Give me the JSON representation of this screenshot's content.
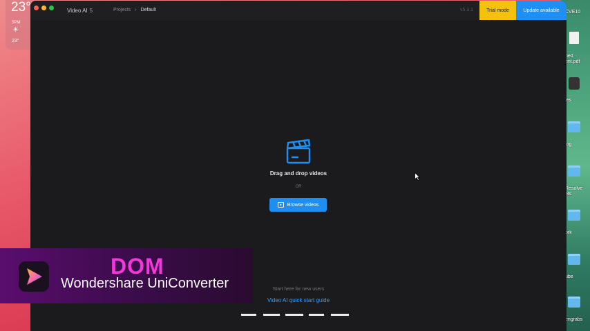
{
  "weather": {
    "temp": "23°",
    "time": "5PM",
    "low": "23°"
  },
  "desktop": {
    "items": [
      {
        "label": "CVE10"
      },
      {
        "label": "ned"
      },
      {
        "label": "ent.pdf"
      },
      {
        "label": "ies"
      },
      {
        "label": "log"
      },
      {
        "label": "Resolve"
      },
      {
        "label": "ets"
      },
      {
        "label": "ork"
      },
      {
        "label": "ube"
      },
      {
        "label": "engrabs"
      }
    ]
  },
  "app": {
    "title": "Video AI",
    "version": "5",
    "breadcrumb": {
      "root": "Projects",
      "current": "Default"
    },
    "version_tag": "v5.3.1",
    "trial_label": "Trial mode",
    "update_label": "Update available"
  },
  "dropzone": {
    "heading": "Drag and drop videos",
    "or": "OR",
    "browse_label": "Browse videos",
    "start_here": "Start here for new users",
    "quick_start": "Video AI quick start guide"
  },
  "banner": {
    "title": "DOM",
    "subtitle": "Wondershare UniConverter"
  },
  "colors": {
    "accent": "#1e8ff0",
    "trial": "#f4c20d",
    "banner_title": "#f238d8"
  }
}
